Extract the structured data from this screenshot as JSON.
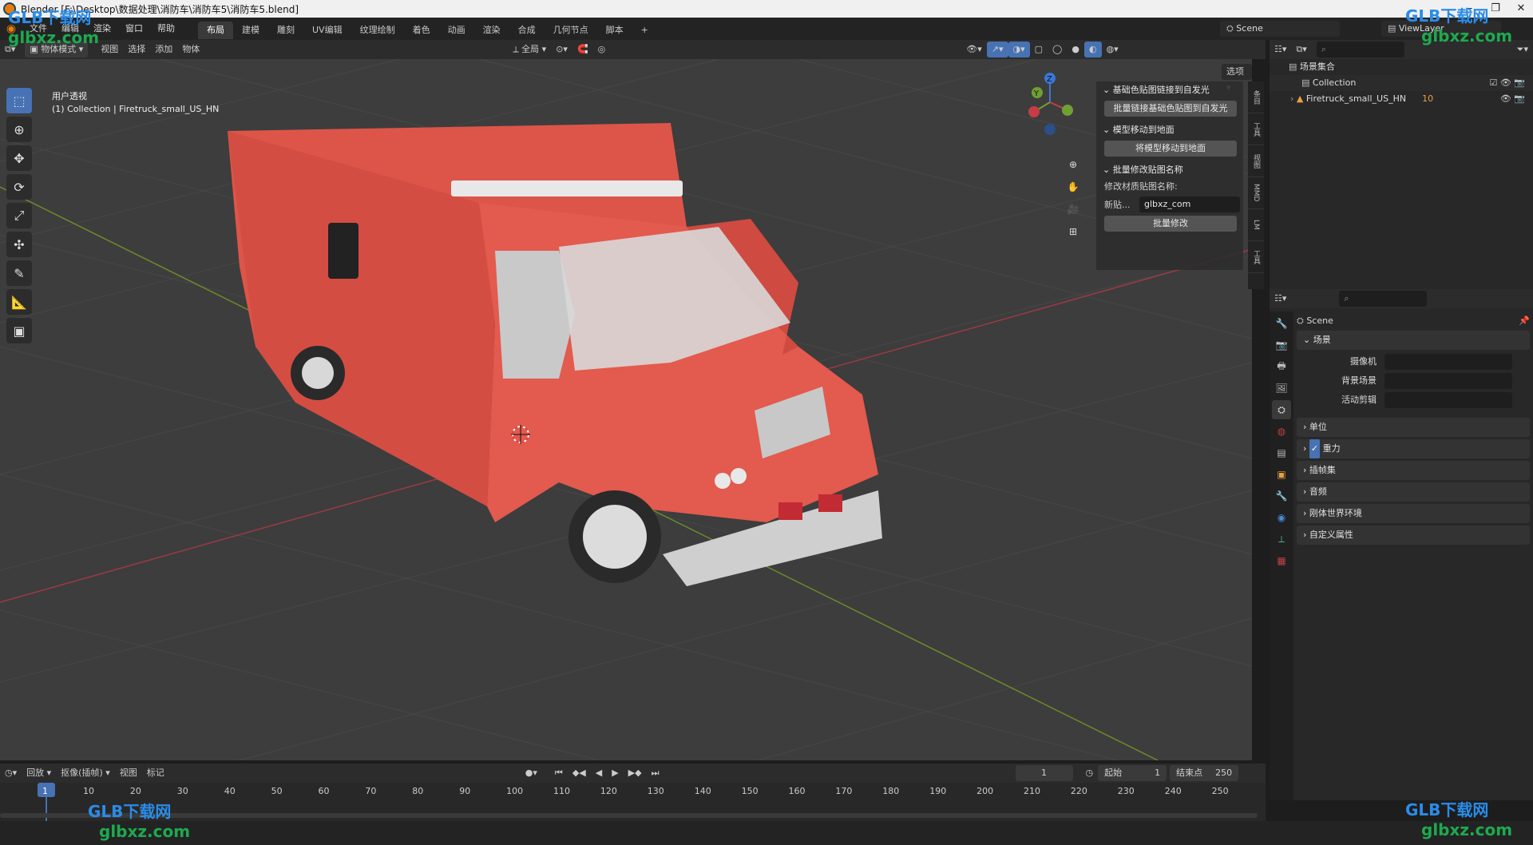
{
  "window": {
    "title": "Blender [F:\\Desktop\\数据处理\\消防车\\消防车5\\消防车5.blend]"
  },
  "menu": [
    "文件",
    "编辑",
    "渲染",
    "窗口",
    "帮助"
  ],
  "workspaces": [
    "布局",
    "建模",
    "雕刻",
    "UV编辑",
    "纹理绘制",
    "着色",
    "动画",
    "渲染",
    "合成",
    "几何节点",
    "脚本"
  ],
  "active_workspace": "布局",
  "scene_name": "Scene",
  "view_layer": "ViewLayer",
  "viewport_header": {
    "mode": "物体模式",
    "menus": [
      "视图",
      "选择",
      "添加",
      "物体"
    ],
    "transform_orientation": "全局",
    "options_label": "选项"
  },
  "viewport": {
    "view_name": "用户透视",
    "collection_info": "(1) Collection | Firetruck_small_US_HN",
    "background_color": "#3d3d3d",
    "gizmo_axes": [
      "X",
      "Y",
      "Z"
    ]
  },
  "npanel": {
    "sections": [
      {
        "title": "基础色贴图链接到自发光",
        "button": "批量链接基础色贴图到自发光"
      },
      {
        "title": "模型移动到地面",
        "button": "将模型移动到地面"
      },
      {
        "title": "批量修改贴图名称",
        "label": "修改材质贴图名称:",
        "field_label": "新贴...",
        "field_value": "glbxz_com",
        "button": "批量修改"
      }
    ],
    "tabs": [
      "条目",
      "工具",
      "视图",
      "MMD",
      "LM",
      "工具"
    ]
  },
  "outliner": {
    "root": "场景集合",
    "items": [
      {
        "name": "Collection",
        "type": "collection"
      },
      {
        "name": "Firetruck_small_US_HN",
        "type": "object",
        "badge": "10"
      }
    ]
  },
  "properties": {
    "context": "Scene",
    "scene_panel": "场景",
    "rows": [
      {
        "label": "摄像机",
        "value": ""
      },
      {
        "label": "背景场景",
        "value": ""
      },
      {
        "label": "活动剪辑",
        "value": ""
      }
    ],
    "collapsed_panels": [
      "单位",
      "重力",
      "插帧集",
      "音频",
      "刚体世界环境",
      "自定义属性"
    ],
    "gravity_checked": true
  },
  "timeline": {
    "menus": [
      "回放",
      "抠像(插帧)",
      "视图",
      "标记"
    ],
    "current_frame": "1",
    "start_label": "起始",
    "start_value": "1",
    "end_label": "结束点",
    "end_value": "250",
    "ticks": [
      "1",
      "10",
      "20",
      "30",
      "40",
      "50",
      "60",
      "70",
      "80",
      "90",
      "100",
      "110",
      "120",
      "130",
      "140",
      "150",
      "160",
      "170",
      "180",
      "190",
      "200",
      "210",
      "220",
      "230",
      "240",
      "250"
    ]
  },
  "watermarks": {
    "brand": "GLB下载网",
    "url": "glbxz.com"
  },
  "colors": {
    "accent": "#4772b3",
    "truck_red": "#e1554b",
    "x_axis": "#c83c46",
    "y_axis": "#6fa032",
    "z_axis": "#3a78d8"
  }
}
